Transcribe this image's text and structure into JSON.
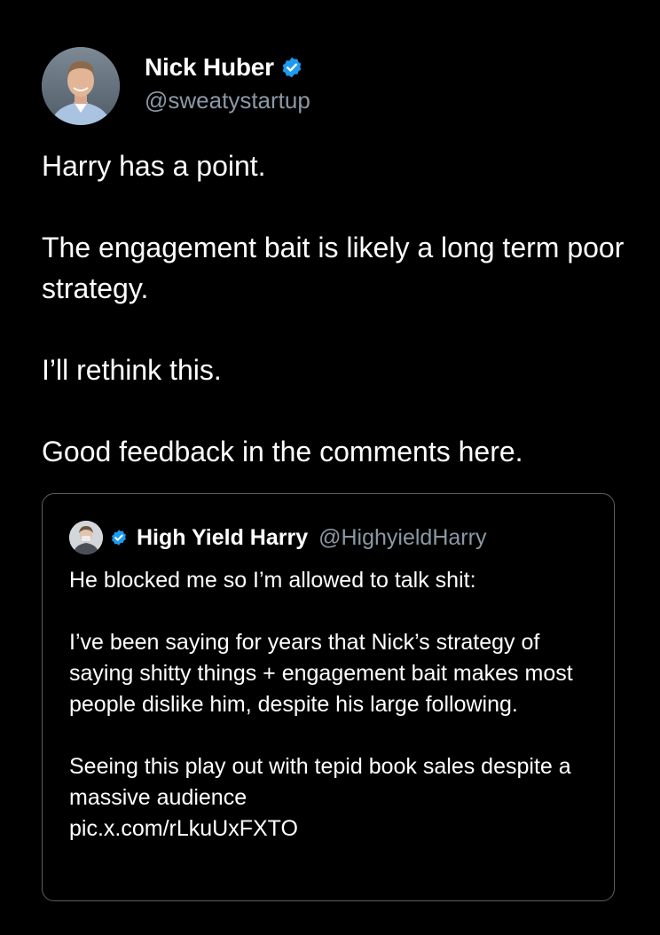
{
  "colors": {
    "background": "#000000",
    "text_primary": "#ffffff",
    "text_secondary": "#8b98a5",
    "verified_badge": "#1d9bf0",
    "quote_border": "#5a5f66"
  },
  "tweet": {
    "author": {
      "display_name": "Nick Huber",
      "handle": "@sweatystartup",
      "verified": true,
      "avatar_icon": "profile-photo"
    },
    "paragraphs": [
      "Harry has a point.",
      "The engagement bait is likely a long term poor strategy.",
      "I’ll rethink this.",
      "Good feedback in the comments here."
    ],
    "quoted": {
      "display_name": "High Yield Harry",
      "handle": "@HighyieldHarry",
      "verified": true,
      "avatar_icon": "profile-photo",
      "paragraphs": [
        "He blocked me so I’m allowed to talk shit:",
        "I’ve been saying for years that Nick’s strategy of saying shitty things + engagement bait makes most people dislike him, despite his large following.",
        "Seeing this play out with tepid book sales despite a massive audience"
      ],
      "link": "pic.x.com/rLkuUxFXTO"
    }
  }
}
